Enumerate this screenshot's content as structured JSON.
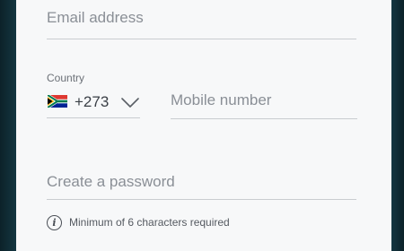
{
  "form": {
    "email": {
      "placeholder": "Email address",
      "value": ""
    },
    "country": {
      "label": "Country",
      "flag_icon": "south-africa-flag-icon",
      "dial_code": "+273",
      "chevron_icon": "chevron-down-icon"
    },
    "mobile": {
      "placeholder": "Mobile number",
      "value": ""
    },
    "password": {
      "placeholder": "Create a password",
      "value": ""
    },
    "password_hint": {
      "icon": "info-icon",
      "text": "Minimum of 6 characters required"
    }
  },
  "colors": {
    "background": "#153640",
    "card": "#f7f8f9",
    "placeholder": "#8a8f96",
    "underline": "#c9ccd0"
  }
}
